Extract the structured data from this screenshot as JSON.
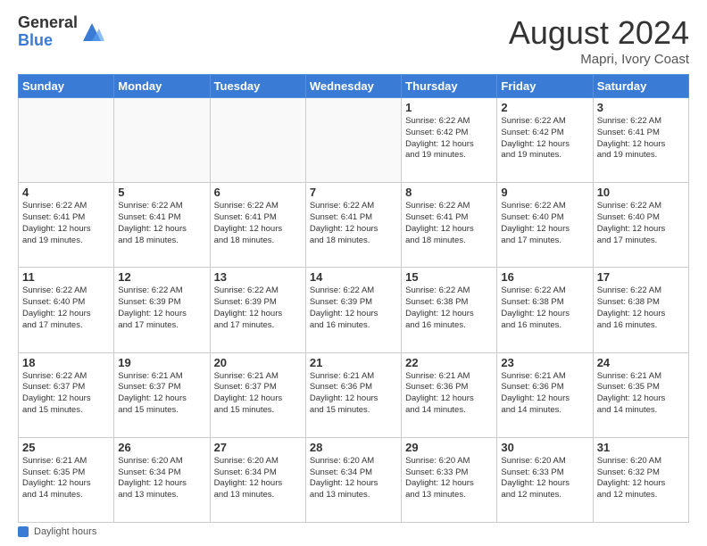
{
  "header": {
    "logo_general": "General",
    "logo_blue": "Blue",
    "month_year": "August 2024",
    "location": "Mapri, Ivory Coast"
  },
  "days_of_week": [
    "Sunday",
    "Monday",
    "Tuesday",
    "Wednesday",
    "Thursday",
    "Friday",
    "Saturday"
  ],
  "weeks": [
    [
      {
        "day": "",
        "info": ""
      },
      {
        "day": "",
        "info": ""
      },
      {
        "day": "",
        "info": ""
      },
      {
        "day": "",
        "info": ""
      },
      {
        "day": "1",
        "info": "Sunrise: 6:22 AM\nSunset: 6:42 PM\nDaylight: 12 hours\nand 19 minutes."
      },
      {
        "day": "2",
        "info": "Sunrise: 6:22 AM\nSunset: 6:42 PM\nDaylight: 12 hours\nand 19 minutes."
      },
      {
        "day": "3",
        "info": "Sunrise: 6:22 AM\nSunset: 6:41 PM\nDaylight: 12 hours\nand 19 minutes."
      }
    ],
    [
      {
        "day": "4",
        "info": "Sunrise: 6:22 AM\nSunset: 6:41 PM\nDaylight: 12 hours\nand 19 minutes."
      },
      {
        "day": "5",
        "info": "Sunrise: 6:22 AM\nSunset: 6:41 PM\nDaylight: 12 hours\nand 18 minutes."
      },
      {
        "day": "6",
        "info": "Sunrise: 6:22 AM\nSunset: 6:41 PM\nDaylight: 12 hours\nand 18 minutes."
      },
      {
        "day": "7",
        "info": "Sunrise: 6:22 AM\nSunset: 6:41 PM\nDaylight: 12 hours\nand 18 minutes."
      },
      {
        "day": "8",
        "info": "Sunrise: 6:22 AM\nSunset: 6:41 PM\nDaylight: 12 hours\nand 18 minutes."
      },
      {
        "day": "9",
        "info": "Sunrise: 6:22 AM\nSunset: 6:40 PM\nDaylight: 12 hours\nand 17 minutes."
      },
      {
        "day": "10",
        "info": "Sunrise: 6:22 AM\nSunset: 6:40 PM\nDaylight: 12 hours\nand 17 minutes."
      }
    ],
    [
      {
        "day": "11",
        "info": "Sunrise: 6:22 AM\nSunset: 6:40 PM\nDaylight: 12 hours\nand 17 minutes."
      },
      {
        "day": "12",
        "info": "Sunrise: 6:22 AM\nSunset: 6:39 PM\nDaylight: 12 hours\nand 17 minutes."
      },
      {
        "day": "13",
        "info": "Sunrise: 6:22 AM\nSunset: 6:39 PM\nDaylight: 12 hours\nand 17 minutes."
      },
      {
        "day": "14",
        "info": "Sunrise: 6:22 AM\nSunset: 6:39 PM\nDaylight: 12 hours\nand 16 minutes."
      },
      {
        "day": "15",
        "info": "Sunrise: 6:22 AM\nSunset: 6:38 PM\nDaylight: 12 hours\nand 16 minutes."
      },
      {
        "day": "16",
        "info": "Sunrise: 6:22 AM\nSunset: 6:38 PM\nDaylight: 12 hours\nand 16 minutes."
      },
      {
        "day": "17",
        "info": "Sunrise: 6:22 AM\nSunset: 6:38 PM\nDaylight: 12 hours\nand 16 minutes."
      }
    ],
    [
      {
        "day": "18",
        "info": "Sunrise: 6:22 AM\nSunset: 6:37 PM\nDaylight: 12 hours\nand 15 minutes."
      },
      {
        "day": "19",
        "info": "Sunrise: 6:21 AM\nSunset: 6:37 PM\nDaylight: 12 hours\nand 15 minutes."
      },
      {
        "day": "20",
        "info": "Sunrise: 6:21 AM\nSunset: 6:37 PM\nDaylight: 12 hours\nand 15 minutes."
      },
      {
        "day": "21",
        "info": "Sunrise: 6:21 AM\nSunset: 6:36 PM\nDaylight: 12 hours\nand 15 minutes."
      },
      {
        "day": "22",
        "info": "Sunrise: 6:21 AM\nSunset: 6:36 PM\nDaylight: 12 hours\nand 14 minutes."
      },
      {
        "day": "23",
        "info": "Sunrise: 6:21 AM\nSunset: 6:36 PM\nDaylight: 12 hours\nand 14 minutes."
      },
      {
        "day": "24",
        "info": "Sunrise: 6:21 AM\nSunset: 6:35 PM\nDaylight: 12 hours\nand 14 minutes."
      }
    ],
    [
      {
        "day": "25",
        "info": "Sunrise: 6:21 AM\nSunset: 6:35 PM\nDaylight: 12 hours\nand 14 minutes."
      },
      {
        "day": "26",
        "info": "Sunrise: 6:20 AM\nSunset: 6:34 PM\nDaylight: 12 hours\nand 13 minutes."
      },
      {
        "day": "27",
        "info": "Sunrise: 6:20 AM\nSunset: 6:34 PM\nDaylight: 12 hours\nand 13 minutes."
      },
      {
        "day": "28",
        "info": "Sunrise: 6:20 AM\nSunset: 6:34 PM\nDaylight: 12 hours\nand 13 minutes."
      },
      {
        "day": "29",
        "info": "Sunrise: 6:20 AM\nSunset: 6:33 PM\nDaylight: 12 hours\nand 13 minutes."
      },
      {
        "day": "30",
        "info": "Sunrise: 6:20 AM\nSunset: 6:33 PM\nDaylight: 12 hours\nand 12 minutes."
      },
      {
        "day": "31",
        "info": "Sunrise: 6:20 AM\nSunset: 6:32 PM\nDaylight: 12 hours\nand 12 minutes."
      }
    ]
  ],
  "footer": {
    "daylight_label": "Daylight hours"
  }
}
